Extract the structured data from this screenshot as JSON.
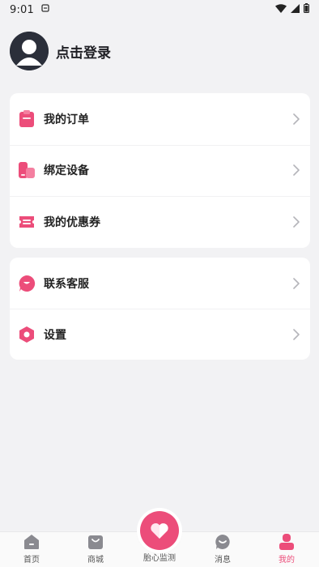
{
  "status_bar": {
    "time": "9:01"
  },
  "profile": {
    "login_text": "点击登录"
  },
  "menu_group_1": [
    {
      "label": "我的订单",
      "icon": "order-icon"
    },
    {
      "label": "绑定设备",
      "icon": "device-icon"
    },
    {
      "label": "我的优惠券",
      "icon": "coupon-icon"
    }
  ],
  "menu_group_2": [
    {
      "label": "联系客服",
      "icon": "customer-service-icon"
    },
    {
      "label": "设置",
      "icon": "settings-icon"
    }
  ],
  "tabbar": {
    "home": "首页",
    "mall": "商城",
    "center": "胎心监测",
    "messages": "消息",
    "mine": "我的",
    "active": "mine"
  },
  "colors": {
    "accent": "#ec4d7a",
    "background": "#f2f2f4"
  }
}
